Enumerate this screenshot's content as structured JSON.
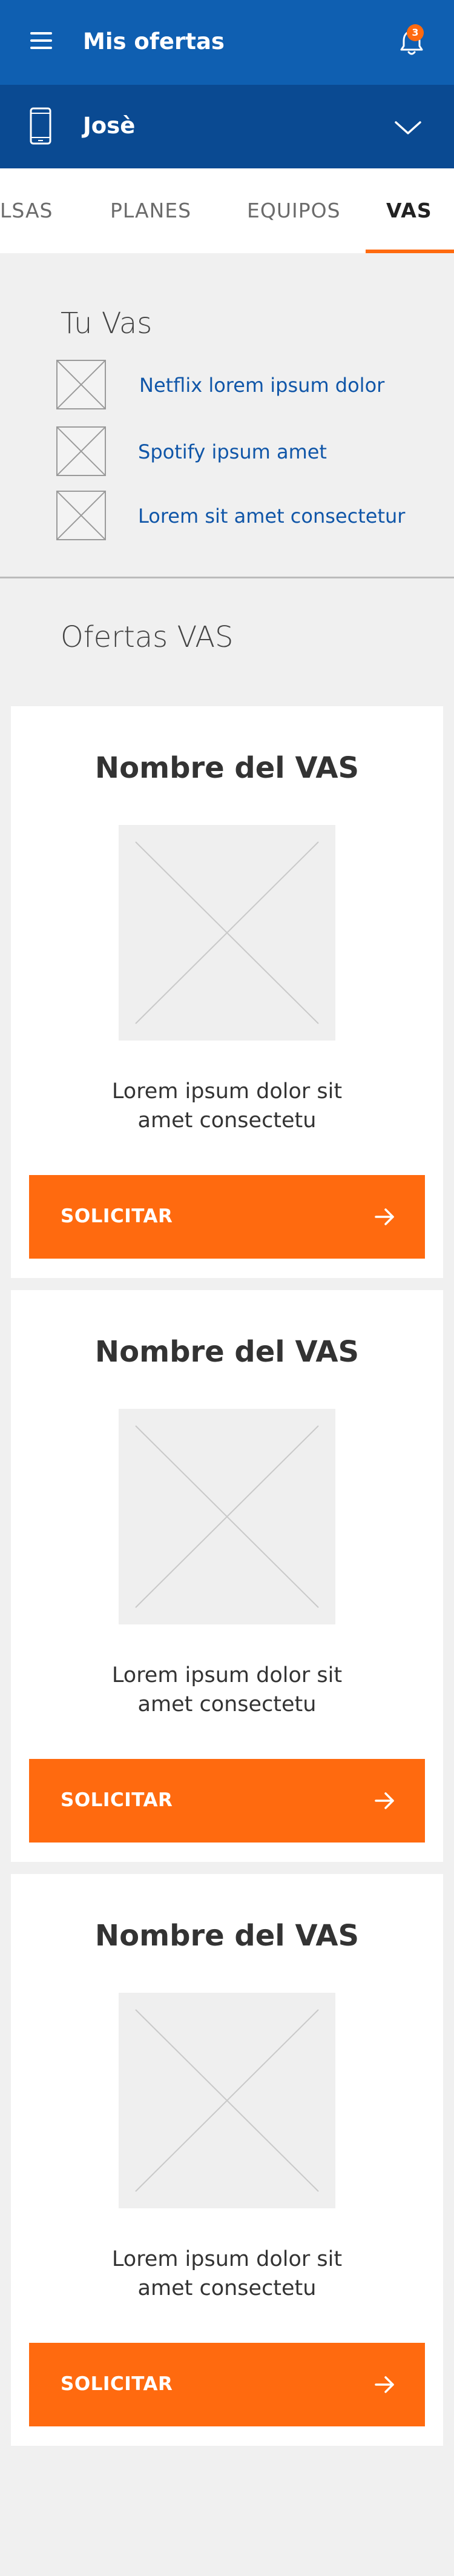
{
  "header": {
    "title": "Mis ofertas",
    "menu_icon": "menu-icon",
    "bell_icon": "bell-icon",
    "notification_count": "3",
    "colors": {
      "background": "#0f5fb1",
      "badge": "#ff6a0f"
    }
  },
  "account": {
    "name": "Josè",
    "device_icon": "phone-icon",
    "expand_icon": "chevron-down-icon",
    "colors": {
      "background": "#0a4a92"
    }
  },
  "tabs": [
    {
      "label": "LSAS",
      "active": false
    },
    {
      "label": "PLANES",
      "active": false
    },
    {
      "label": "EQUIPOS",
      "active": false
    },
    {
      "label": "VAS",
      "active": true
    }
  ],
  "tu_vas": {
    "title": "Tu Vas",
    "items": [
      {
        "label": "Netflix lorem ipsum dolor"
      },
      {
        "label": "Spotify ipsum amet"
      },
      {
        "label": "Lorem sit amet consectetur"
      }
    ]
  },
  "ofertas": {
    "title": "Ofertas VAS",
    "cards": [
      {
        "title": "Nombre del VAS",
        "desc_line1": "Lorem ipsum dolor sit",
        "desc_line2": "amet consectetu",
        "button": "SOLICITAR"
      },
      {
        "title": "Nombre del VAS",
        "desc_line1": "Lorem ipsum dolor sit",
        "desc_line2": "amet consectetu",
        "button": "SOLICITAR"
      },
      {
        "title": "Nombre del VAS",
        "desc_line1": "Lorem ipsum dolor sit",
        "desc_line2": "amet consectetu",
        "button": "SOLICITAR"
      }
    ]
  },
  "colors": {
    "accent": "#ff6a0f",
    "link": "#1056a8",
    "page_bg": "#f0f0f0"
  }
}
